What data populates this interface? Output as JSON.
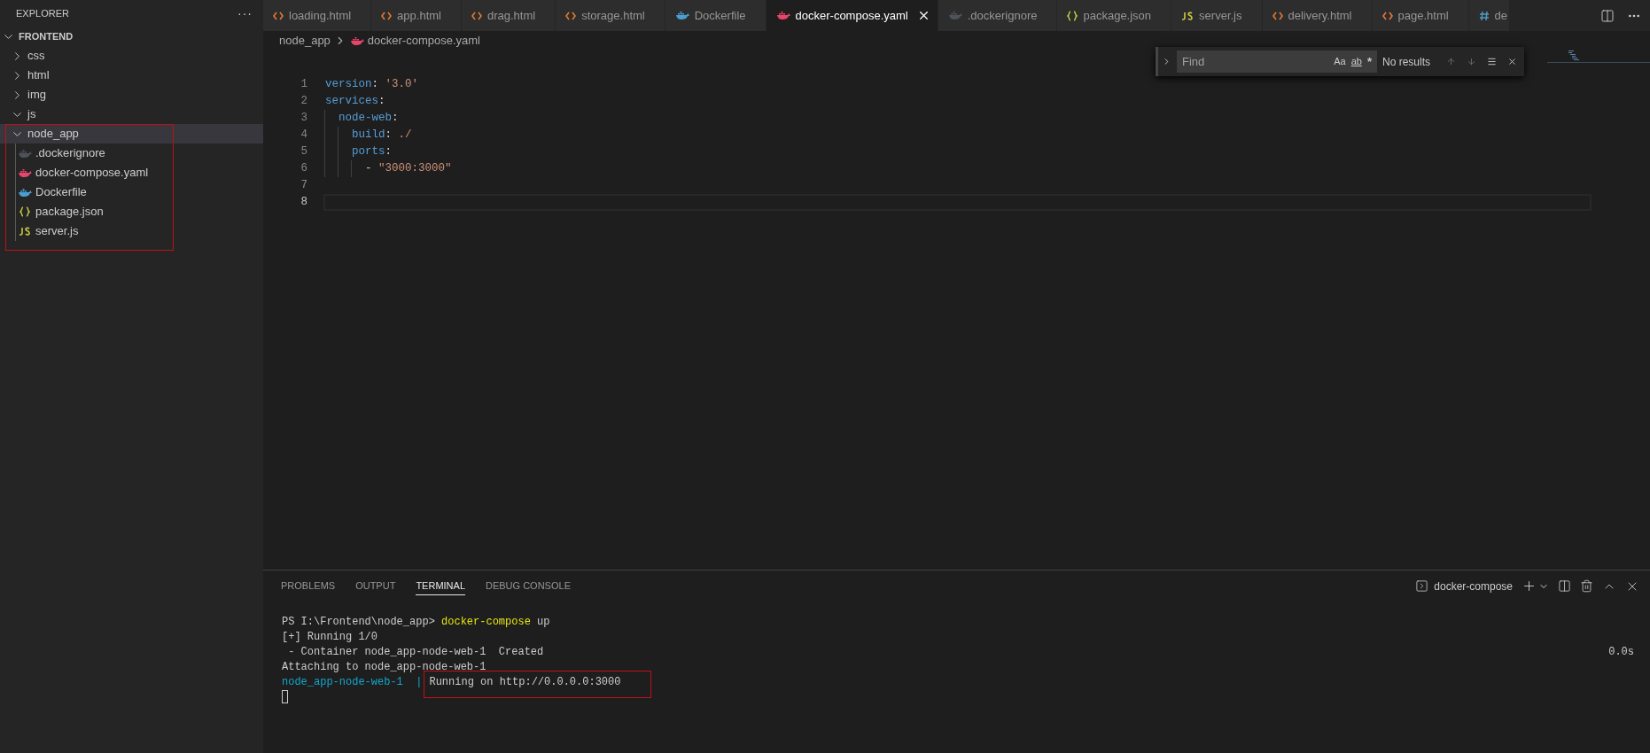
{
  "sidebar": {
    "title": "EXPLORER",
    "more": "···",
    "root": {
      "label": "FRONTEND",
      "expanded": true,
      "children": [
        {
          "label": "css",
          "kind": "folder",
          "expanded": false,
          "selected": false
        },
        {
          "label": "html",
          "kind": "folder",
          "expanded": false,
          "selected": false
        },
        {
          "label": "img",
          "kind": "folder",
          "expanded": false,
          "selected": false
        },
        {
          "label": "js",
          "kind": "folder",
          "expanded": true,
          "selected": false
        },
        {
          "label": "node_app",
          "kind": "folder",
          "expanded": true,
          "selected": true,
          "children": [
            {
              "label": ".dockerignore",
              "kind": "docker",
              "color": "#4d5359",
              "selected": false
            },
            {
              "label": "docker-compose.yaml",
              "kind": "docker",
              "color": "#e8456b",
              "selected": false
            },
            {
              "label": "Dockerfile",
              "kind": "docker",
              "color": "#4a9fd1",
              "selected": false
            },
            {
              "label": "package.json",
              "kind": "json",
              "selected": false
            },
            {
              "label": "server.js",
              "kind": "js",
              "selected": false
            }
          ]
        }
      ]
    }
  },
  "tabs": [
    {
      "label": "loading.html",
      "kind": "html",
      "selected": false
    },
    {
      "label": "app.html",
      "kind": "html",
      "selected": false
    },
    {
      "label": "drag.html",
      "kind": "html",
      "selected": false
    },
    {
      "label": "storage.html",
      "kind": "html",
      "selected": false
    },
    {
      "label": "Dockerfile",
      "kind": "docker",
      "color": "#4a9fd1",
      "selected": false
    },
    {
      "label": "docker-compose.yaml",
      "kind": "docker",
      "color": "#e8456b",
      "selected": true
    },
    {
      "label": ".dockerignore",
      "kind": "docker",
      "color": "#4d5359",
      "selected": false
    },
    {
      "label": "package.json",
      "kind": "json",
      "selected": false
    },
    {
      "label": "server.js",
      "kind": "js",
      "selected": false
    },
    {
      "label": "delivery.html",
      "kind": "html",
      "selected": false
    },
    {
      "label": "page.html",
      "kind": "html",
      "selected": false
    },
    {
      "label": "de",
      "kind": "css",
      "selected": false
    }
  ],
  "breadcrumb": [
    {
      "label": "node_app",
      "kind": "text"
    },
    {
      "label": "docker-compose.yaml",
      "kind": "docker",
      "color": "#e8456b"
    }
  ],
  "find": {
    "placeholder": "Find",
    "options": [
      "Aa",
      "ab",
      "*"
    ],
    "result": "No results"
  },
  "editor": {
    "lines": [
      {
        "number": "1",
        "selected": false,
        "tokens": [
          {
            "text": "version",
            "kind": "key"
          },
          {
            "text": ": ",
            "kind": "punct"
          },
          {
            "text": "'3.0'",
            "kind": "string"
          }
        ]
      },
      {
        "number": "2",
        "selected": false,
        "tokens": [
          {
            "text": "services",
            "kind": "key"
          },
          {
            "text": ":",
            "kind": "punct"
          }
        ]
      },
      {
        "number": "3",
        "selected": false,
        "tokens": [
          {
            "text": "  node-web",
            "kind": "key"
          },
          {
            "text": ":",
            "kind": "punct"
          }
        ]
      },
      {
        "number": "4",
        "selected": false,
        "tokens": [
          {
            "text": "    build",
            "kind": "key"
          },
          {
            "text": ": ",
            "kind": "punct"
          },
          {
            "text": "./",
            "kind": "string"
          }
        ]
      },
      {
        "number": "5",
        "selected": false,
        "tokens": [
          {
            "text": "    ports",
            "kind": "key"
          },
          {
            "text": ":",
            "kind": "punct"
          }
        ]
      },
      {
        "number": "6",
        "selected": false,
        "tokens": [
          {
            "text": "      - ",
            "kind": "punct"
          },
          {
            "text": "\"3000:3000\"",
            "kind": "string"
          }
        ]
      },
      {
        "number": "7",
        "selected": false
      },
      {
        "number": "8",
        "selected": true
      }
    ]
  },
  "panel": {
    "tabs": [
      {
        "label": "PROBLEMS",
        "selected": false
      },
      {
        "label": "OUTPUT",
        "selected": false
      },
      {
        "label": "TERMINAL",
        "selected": true
      },
      {
        "label": "DEBUG CONSOLE",
        "selected": false
      }
    ],
    "terminal_name": "docker-compose",
    "lines": [
      {
        "tokens": [
          {
            "text": "PS I:\\Frontend\\node_app> ",
            "kind": "plain"
          },
          {
            "text": "docker-compose",
            "kind": "command"
          },
          {
            "text": " up",
            "kind": "plain"
          }
        ]
      },
      {
        "tokens": [
          {
            "text": "[+] Running 1/0",
            "kind": "plain"
          }
        ]
      },
      {
        "tokens": [
          {
            "text": " - Container node_app-node-web-1  Created",
            "kind": "plain"
          }
        ],
        "right": "0.0s"
      },
      {
        "tokens": [
          {
            "text": "Attaching to node_app-node-web-1",
            "kind": "plain"
          }
        ]
      },
      {
        "tokens": [
          {
            "text": "node_app-node-web-1  |",
            "kind": "prefix"
          },
          {
            "text": "Running on http://0.0.0.0:3000",
            "kind": "plain",
            "highlighted": true
          }
        ]
      }
    ]
  }
}
